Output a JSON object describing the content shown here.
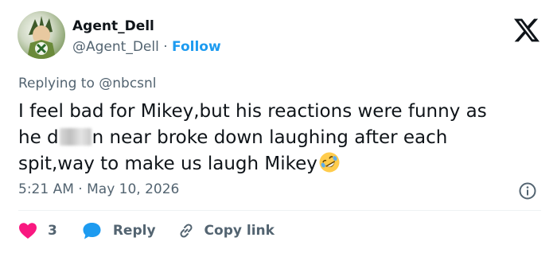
{
  "author": {
    "name": "Agent_Dell",
    "handle": "@Agent_Dell",
    "separator": "·",
    "follow_label": "Follow"
  },
  "reply_context": {
    "prefix": "Replying to",
    "mention": "@nbcsnl"
  },
  "tweet": {
    "line1": "I feel bad for Mikey,but his reactions were funny as",
    "line2_before": "he d",
    "line2_after": "n near broke down laughing after each",
    "line3": "spit,way to make us laugh Mikey",
    "emoji_icon": "rolling-on-floor-laughing-emoji"
  },
  "meta": {
    "time": "5:21 AM",
    "separator": "·",
    "date": "May 10, 2026"
  },
  "actions": {
    "like_count": "3",
    "reply_label": "Reply",
    "copy_label": "Copy link"
  },
  "colors": {
    "accent": "#1d9bf0",
    "like": "#f91880",
    "muted": "#536471",
    "text": "#0f1419"
  }
}
